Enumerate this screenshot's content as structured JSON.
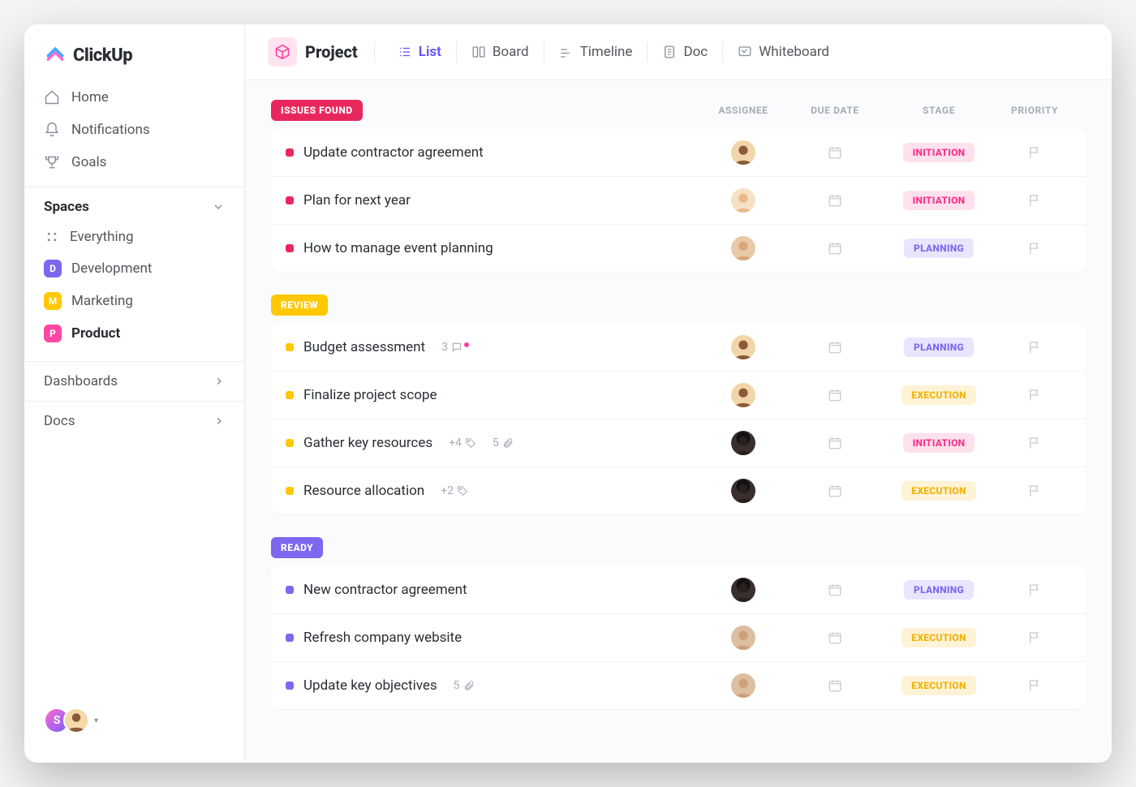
{
  "brand": "ClickUp",
  "sidebar": {
    "nav": [
      {
        "label": "Home"
      },
      {
        "label": "Notifications"
      },
      {
        "label": "Goals"
      }
    ],
    "spaces_header": "Spaces",
    "everything": "Everything",
    "space_items": [
      {
        "letter": "D",
        "label": "Development",
        "color": "#7b68ee"
      },
      {
        "letter": "M",
        "label": "Marketing",
        "color": "#ffc800"
      },
      {
        "letter": "P",
        "label": "Product",
        "color": "#ff47a3",
        "active": true
      }
    ],
    "links": [
      {
        "label": "Dashboards"
      },
      {
        "label": "Docs"
      }
    ],
    "footer_initial": "S"
  },
  "header": {
    "title": "Project",
    "views": [
      {
        "label": "List",
        "active": true
      },
      {
        "label": "Board"
      },
      {
        "label": "Timeline"
      },
      {
        "label": "Doc"
      },
      {
        "label": "Whiteboard"
      }
    ]
  },
  "columns": {
    "assignee": "ASSIGNEE",
    "due_date": "DUE DATE",
    "stage": "STAGE",
    "priority": "PRIORITY"
  },
  "groups": [
    {
      "label": "ISSUES FOUND",
      "color": "#e8285d",
      "dot": "#e8285d",
      "tasks": [
        {
          "name": "Update contractor agreement",
          "avatar": "av-1",
          "stage": "INITIATION",
          "stageClass": "stage-initiation"
        },
        {
          "name": "Plan for next year",
          "avatar": "av-2",
          "stage": "INITIATION",
          "stageClass": "stage-initiation"
        },
        {
          "name": "How to manage event planning",
          "avatar": "av-3",
          "stage": "PLANNING",
          "stageClass": "stage-planning"
        }
      ]
    },
    {
      "label": "REVIEW",
      "color": "#ffc800",
      "dot": "#ffc800",
      "tasks": [
        {
          "name": "Budget assessment",
          "avatar": "av-1",
          "stage": "PLANNING",
          "stageClass": "stage-planning",
          "comments": "3",
          "commentNew": true
        },
        {
          "name": "Finalize project scope",
          "avatar": "av-1",
          "stage": "EXECUTION",
          "stageClass": "stage-execution"
        },
        {
          "name": "Gather key resources",
          "avatar": "av-4",
          "stage": "INITIATION",
          "stageClass": "stage-initiation",
          "tags": "+4",
          "attachments": "5"
        },
        {
          "name": "Resource allocation",
          "avatar": "av-4",
          "stage": "EXECUTION",
          "stageClass": "stage-execution",
          "tags": "+2"
        }
      ]
    },
    {
      "label": "READY",
      "color": "#7b68ee",
      "dot": "#7b68ee",
      "tasks": [
        {
          "name": "New contractor agreement",
          "avatar": "av-4",
          "stage": "PLANNING",
          "stageClass": "stage-planning"
        },
        {
          "name": "Refresh company website",
          "avatar": "av-5",
          "stage": "EXECUTION",
          "stageClass": "stage-execution"
        },
        {
          "name": "Update key objectives",
          "avatar": "av-5",
          "stage": "EXECUTION",
          "stageClass": "stage-execution",
          "attachments": "5"
        }
      ]
    }
  ]
}
